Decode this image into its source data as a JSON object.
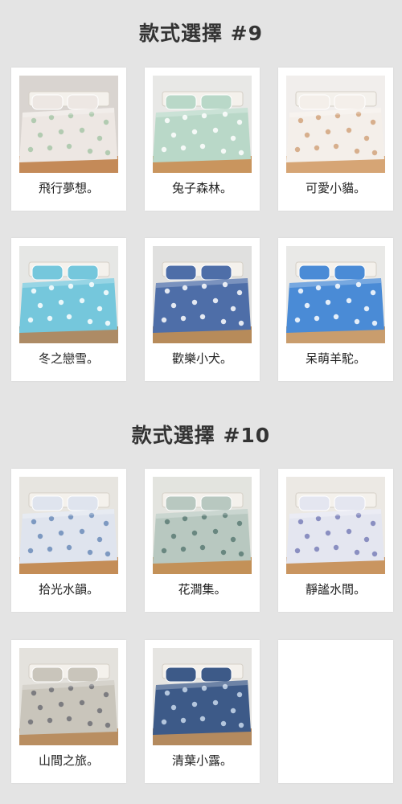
{
  "sections": [
    {
      "title": "款式選擇 #9",
      "items": [
        {
          "label": "飛行夢想。",
          "palette": {
            "wall": "#d9d4d0",
            "bed": "#ede7e3",
            "pattern": "#a7c6a8",
            "floor": "#c48a58"
          }
        },
        {
          "label": "兔子森林。",
          "palette": {
            "wall": "#e8e8e6",
            "bed": "#b9d8c8",
            "pattern": "#ffffff",
            "floor": "#c9955e"
          }
        },
        {
          "label": "可愛小貓。",
          "palette": {
            "wall": "#f1eeec",
            "bed": "#f4efea",
            "pattern": "#d1a37c",
            "floor": "#d6a575"
          }
        },
        {
          "label": "冬之戀雪。",
          "palette": {
            "wall": "#e6e7e5",
            "bed": "#75c7dc",
            "pattern": "#ffffff",
            "floor": "#ad8b65"
          }
        },
        {
          "label": "歡樂小犬。",
          "palette": {
            "wall": "#e0e0df",
            "bed": "#4e6ea8",
            "pattern": "#ffffff",
            "floor": "#b78b5a"
          }
        },
        {
          "label": "呆萌羊駝。",
          "palette": {
            "wall": "#e9e9e7",
            "bed": "#4a8bd6",
            "pattern": "#ffffff",
            "floor": "#c99d6d"
          }
        }
      ]
    },
    {
      "title": "款式選擇 #10",
      "items": [
        {
          "label": "拾光水韻。",
          "palette": {
            "wall": "#e7e5e0",
            "bed": "#dfe4ee",
            "pattern": "#6c8cb8",
            "floor": "#c48d57"
          }
        },
        {
          "label": "花澗集。",
          "palette": {
            "wall": "#e3e4df",
            "bed": "#b8c8c0",
            "pattern": "#5a7b74",
            "floor": "#c39158"
          }
        },
        {
          "label": "靜謐水間。",
          "palette": {
            "wall": "#ece9e4",
            "bed": "#e4e6f0",
            "pattern": "#7a7fb8",
            "floor": "#c99560"
          }
        },
        {
          "label": "山間之旅。",
          "palette": {
            "wall": "#e4e2dd",
            "bed": "#c9c5bb",
            "pattern": "#6e6f75",
            "floor": "#b98e61"
          }
        },
        {
          "label": "清葉小露。",
          "palette": {
            "wall": "#e6e5e2",
            "bed": "#3d5a88",
            "pattern": "#c9d9ec",
            "floor": "#b48a5e"
          }
        }
      ]
    }
  ]
}
